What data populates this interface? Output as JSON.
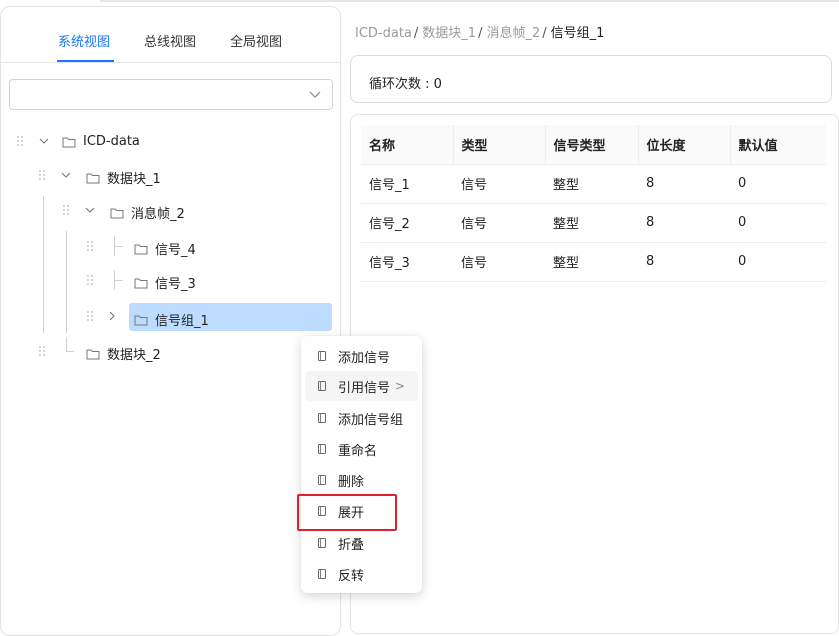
{
  "tabs": [
    {
      "label": "系统视图",
      "active": true
    },
    {
      "label": "总线视图",
      "active": false
    },
    {
      "label": "全局视图",
      "active": false
    }
  ],
  "tree_select": {
    "value": ""
  },
  "tree": {
    "root": "ICD-data",
    "block1": "数据块_1",
    "frame2": "消息帧_2",
    "signal4": "信号_4",
    "signal3": "信号_3",
    "group1": "信号组_1",
    "block2": "数据块_2"
  },
  "breadcrumb": {
    "items": [
      "ICD-data",
      "数据块_1",
      "消息帧_2"
    ],
    "current": "信号组_1",
    "separator": "/"
  },
  "loop": {
    "text": "循环次数 : 0"
  },
  "table": {
    "headers": [
      "名称",
      "类型",
      "信号类型",
      "位长度",
      "默认值"
    ],
    "rows": [
      [
        "信号_1",
        "信号",
        "整型",
        "8",
        "0"
      ],
      [
        "信号_2",
        "信号",
        "整型",
        "8",
        "0"
      ],
      [
        "信号_3",
        "信号",
        "整型",
        "8",
        "0"
      ]
    ]
  },
  "context_menu": {
    "items": [
      {
        "label": "添加信号"
      },
      {
        "label": "引用信号",
        "arrow": ">"
      },
      {
        "label": "添加信号组"
      },
      {
        "label": "重命名"
      },
      {
        "label": "删除"
      },
      {
        "label": "展开"
      },
      {
        "label": "折叠"
      },
      {
        "label": "反转"
      }
    ],
    "highlighted_item": "展开"
  },
  "colors": {
    "accent": "#1677ff",
    "selected_bg": "#bddcff",
    "highlight_border": "#e0202a"
  },
  "icons": [
    "chevron-down-icon",
    "drag-handle-icon",
    "folder-icon",
    "chevron-right-icon",
    "copy-icon"
  ]
}
